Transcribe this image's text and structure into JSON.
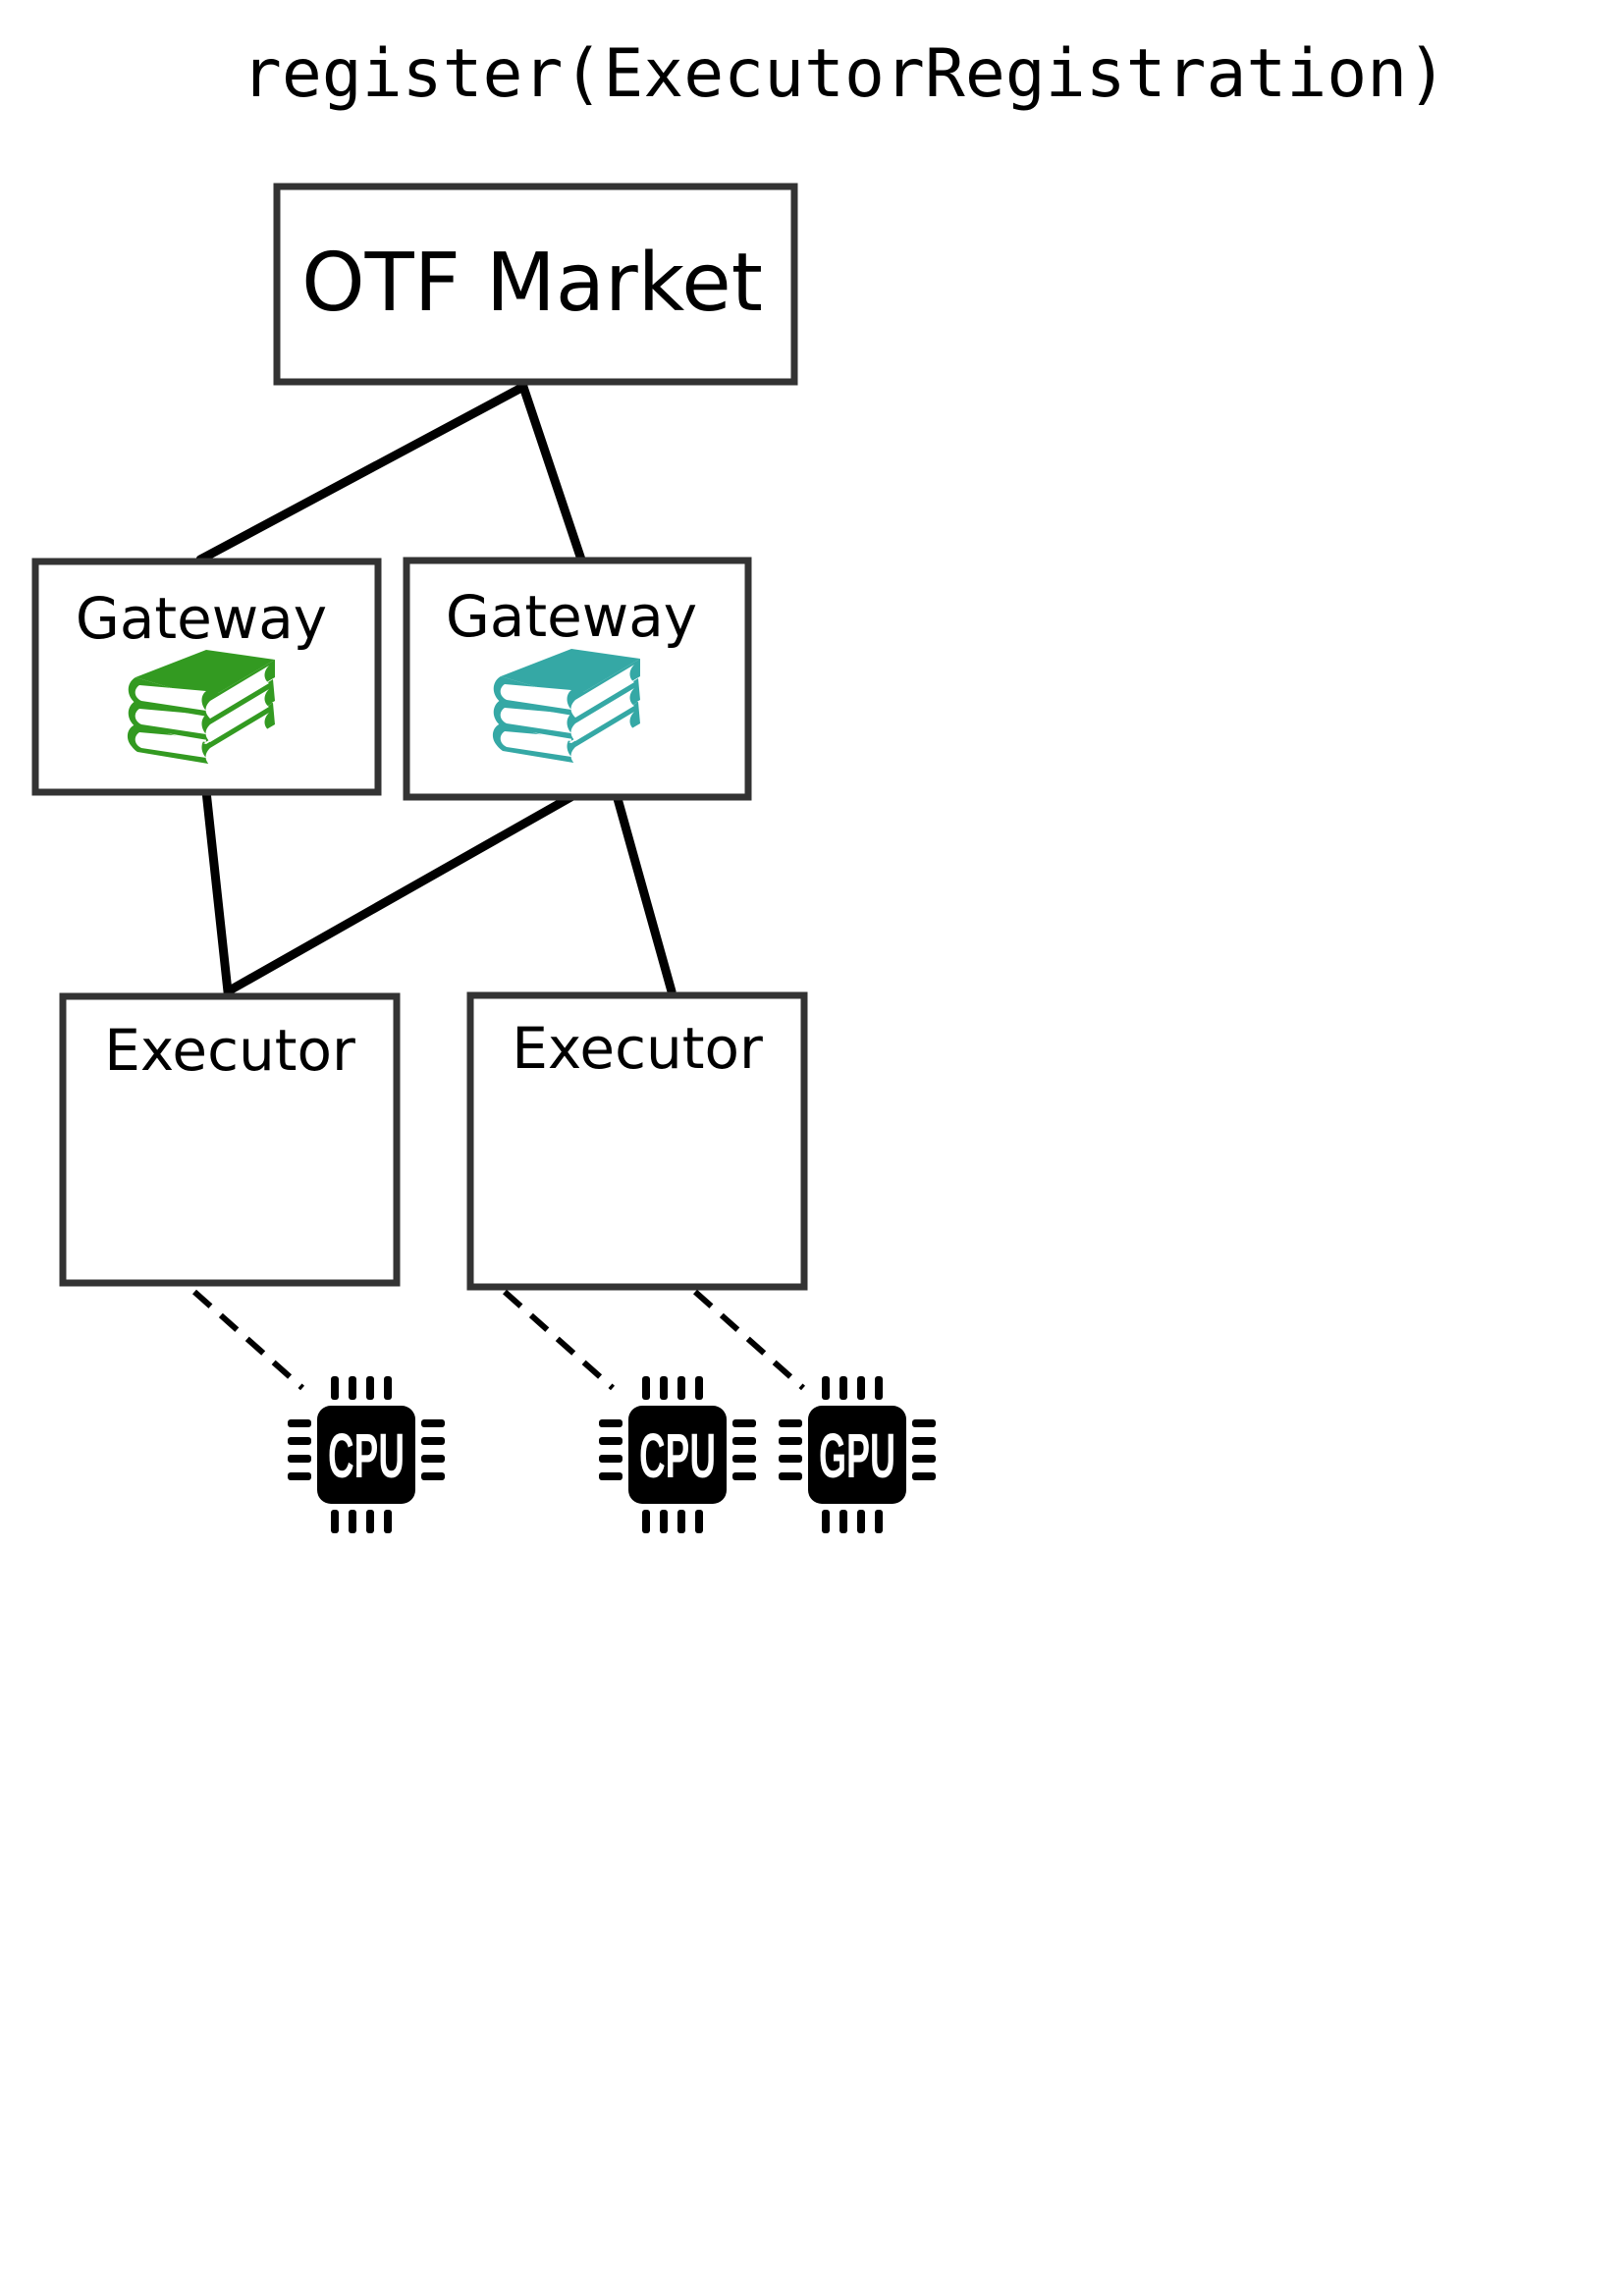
{
  "title": "register(ExecutorRegistration)",
  "market": {
    "label": "OTF Market"
  },
  "gateways": [
    {
      "label": "Gateway",
      "icon": "books-icon",
      "color": "#339a21"
    },
    {
      "label": "Gateway",
      "icon": "books-icon",
      "color": "#35a8a5"
    }
  ],
  "executors": [
    {
      "label": "Executor"
    },
    {
      "label": "Executor"
    }
  ],
  "processors": [
    {
      "label": "CPU",
      "icon": "chip-icon"
    },
    {
      "label": "CPU",
      "icon": "chip-icon"
    },
    {
      "label": "GPU",
      "icon": "chip-icon"
    }
  ]
}
